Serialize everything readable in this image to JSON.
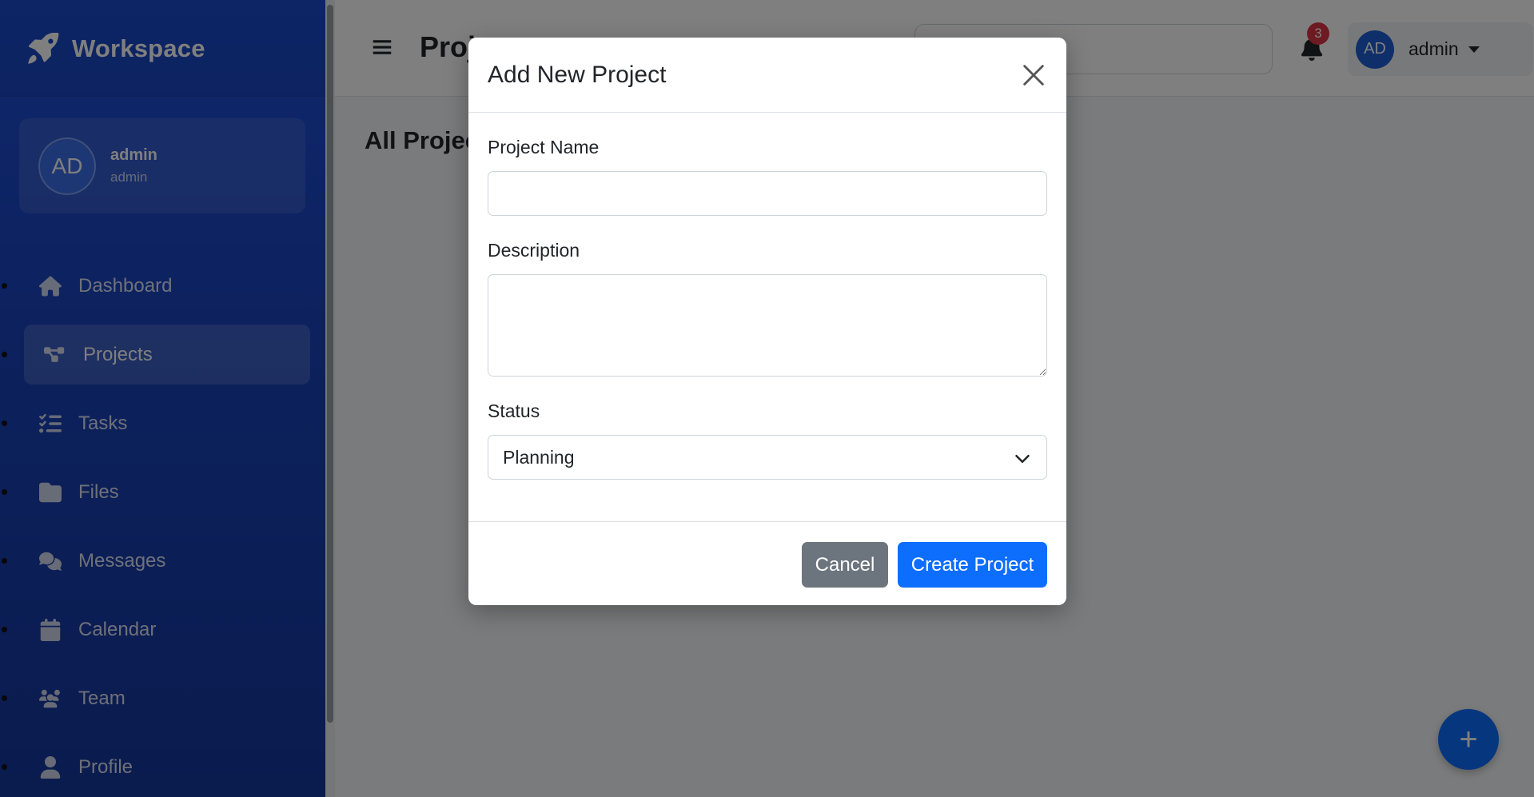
{
  "brand": {
    "name": "Workspace"
  },
  "user_card": {
    "initials": "AD",
    "name": "admin",
    "role": "admin"
  },
  "sidebar": {
    "items": [
      {
        "label": "Dashboard",
        "icon": "home-icon"
      },
      {
        "label": "Projects",
        "icon": "project-diagram-icon",
        "active": true
      },
      {
        "label": "Tasks",
        "icon": "tasks-icon"
      },
      {
        "label": "Files",
        "icon": "folder-icon"
      },
      {
        "label": "Messages",
        "icon": "comments-icon"
      },
      {
        "label": "Calendar",
        "icon": "calendar-icon"
      },
      {
        "label": "Team",
        "icon": "users-icon"
      },
      {
        "label": "Profile",
        "icon": "user-icon"
      }
    ]
  },
  "topbar": {
    "page_title": "Projects",
    "search_placeholder": "",
    "notification_count": "3",
    "user_initials": "AD",
    "user_name": "admin"
  },
  "main": {
    "section_title": "All Projects",
    "fab_label": "+"
  },
  "modal": {
    "title": "Add New Project",
    "fields": {
      "name_label": "Project Name",
      "name_value": "",
      "description_label": "Description",
      "description_value": "",
      "status_label": "Status",
      "status_value": "Planning"
    },
    "cancel_label": "Cancel",
    "submit_label": "Create Project"
  },
  "colors": {
    "sidebar_bg": "#1d4fd8",
    "primary": "#0d6efd",
    "secondary": "#6c757d",
    "badge": "#dc3545"
  }
}
